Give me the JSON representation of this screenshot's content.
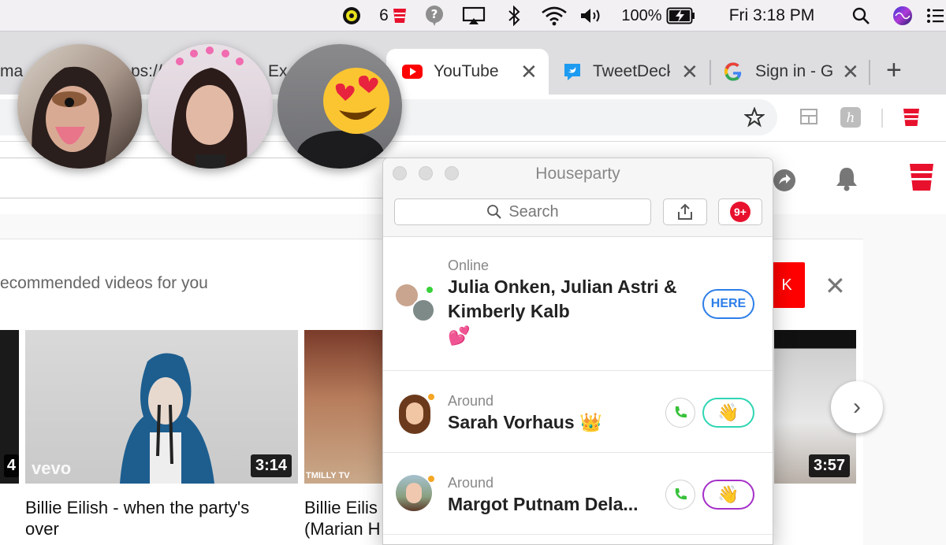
{
  "menubar": {
    "cups_count": "6",
    "battery": "100%",
    "clock": "Fri 3:18 PM"
  },
  "tabs": [
    {
      "label": "ma"
    },
    {
      "label": "ps://"
    },
    {
      "label": "Ex"
    },
    {
      "label": "YouTube"
    },
    {
      "label": "TweetDeck"
    },
    {
      "label": "Sign in - G"
    }
  ],
  "youtube": {
    "recommended_heading": "ecommended videos for you",
    "red_button_fragment": "K",
    "videos": [
      {
        "duration": "4",
        "title": ""
      },
      {
        "duration": "3:14",
        "title": "Billie Eilish - when the party's over",
        "watermark": "vevo"
      },
      {
        "duration": "",
        "title": "Billie Eilis (Marian H",
        "watermark": "TMILLY TV"
      },
      {
        "duration": "3:57",
        "title": ""
      }
    ]
  },
  "houseparty": {
    "title": "Houseparty",
    "search_placeholder": "Search",
    "notification_badge": "9+",
    "rows": [
      {
        "status": "Online",
        "name": "Julia Onken, Julian Astri & Kimberly Kalb",
        "emoji": "💕",
        "action": "HERE"
      },
      {
        "status": "Around",
        "name": "Sarah Vorhaus",
        "emoji": "👑",
        "wave": "👋"
      },
      {
        "status": "Around",
        "name": "Margot Putnam Dela...",
        "emoji": "",
        "wave": "👋"
      }
    ]
  },
  "colors": {
    "accent_blue": "#2d7ee8",
    "wave_teal": "#2fd6b4",
    "wave_purple": "#a530c8",
    "youtube_red": "#ff0000",
    "badge_red": "#e8112d"
  }
}
